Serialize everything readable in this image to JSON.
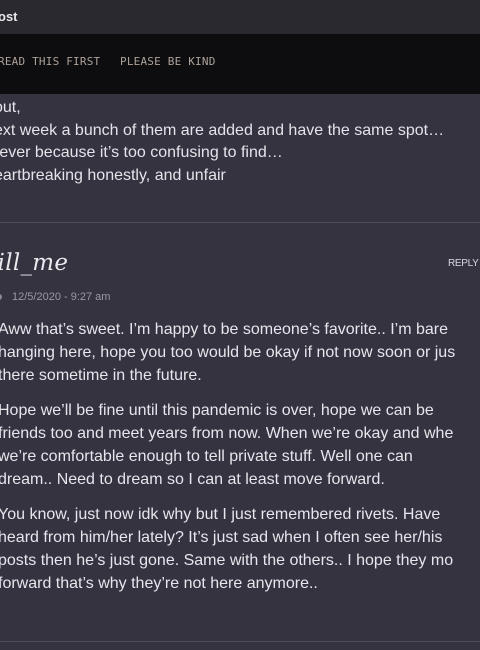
{
  "topbar": {
    "title": "ost"
  },
  "nav": {
    "tab1": "READ THIS FIRST",
    "tab2": "PLEASE BE KIND"
  },
  "previous_comment": {
    "lines": [
      "out,",
      "ext week a bunch of them are added and have the same spot…",
      "rever because it’s too confusing to find…",
      "eartbreaking honestly, and unfair"
    ]
  },
  "comment": {
    "author": "till_me",
    "reply_label": "REPLY",
    "timestamp": "12/5/2020 - 9:27 am",
    "paragraphs": [
      [
        "Aww that’s sweet. I’m happy to be someone’s favorite.. I’m bare",
        "hanging here, hope you too would be okay if not now soon or jus",
        "there sometime in the future."
      ],
      [
        "Hope we’ll be fine until this pandemic is over, hope we can be",
        "friends too and meet years from now. When we’re okay and whe",
        "we’re comfortable enough to tell private stuff. Well one can",
        "dream.. Need to dream so I can at least move forward."
      ],
      [
        "You know, just now idk why but I just remembered rivets. Have",
        "heard from him/her lately? It’s just sad when I often see her/his",
        "posts then he’s just gone. Same with the others.. I hope they mo",
        "forward that’s why they’re not here anymore.."
      ]
    ]
  }
}
